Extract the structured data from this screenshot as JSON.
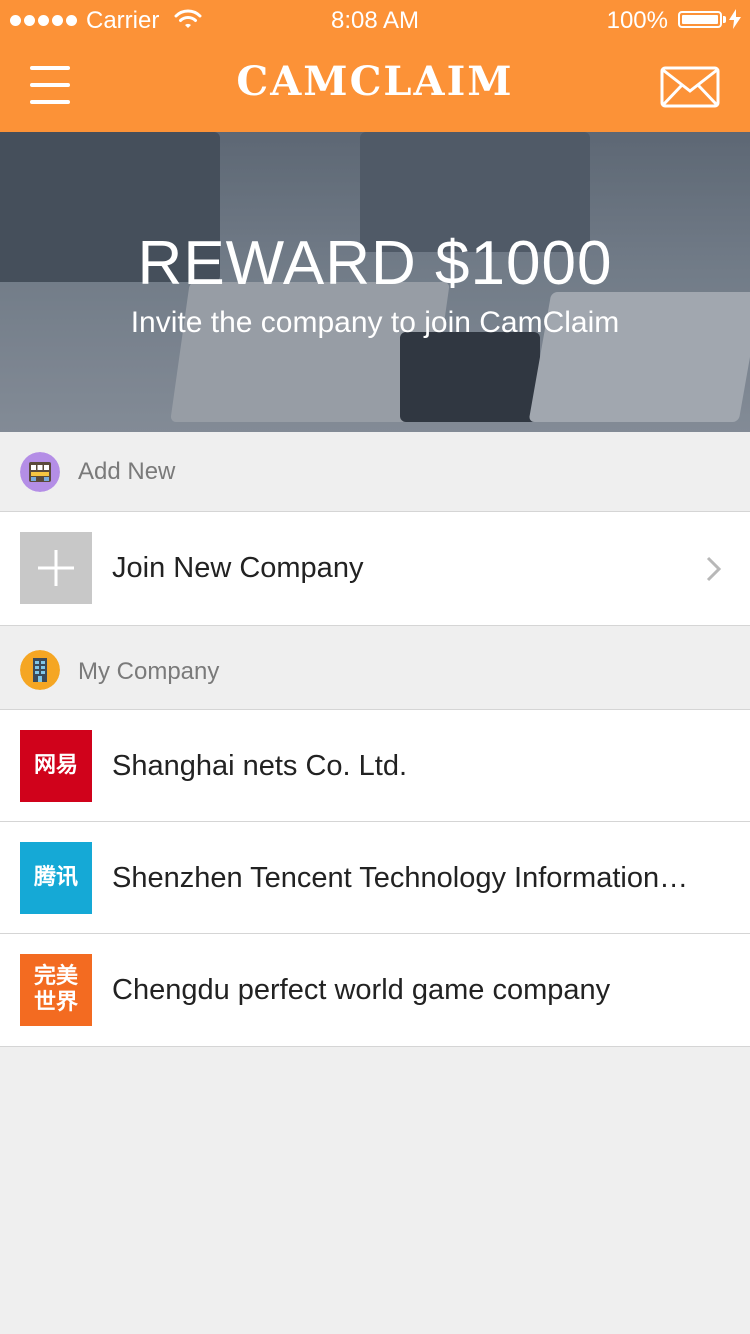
{
  "status_bar": {
    "carrier": "Carrier",
    "time": "8:08 AM",
    "battery": "100%"
  },
  "nav": {
    "logo": "CAMCLAIM",
    "menu_icon": "hamburger-menu-icon",
    "mail_icon": "mail-envelope-icon"
  },
  "banner": {
    "title": "REWARD $1000",
    "subtitle": "Invite the company to join CamClaim"
  },
  "add_new": {
    "section_label": "Add New",
    "section_icon": "store-icon",
    "join_label": "Join New Company",
    "join_icon": "plus-icon"
  },
  "my_company": {
    "section_label": "My Company",
    "section_icon": "building-icon",
    "companies": [
      {
        "logo_text": "网易",
        "name": "Shanghai nets Co. Ltd.",
        "color": "#d0021b"
      },
      {
        "logo_text": "腾讯",
        "name": "Shenzhen Tencent Technology Information…",
        "color": "#15a9d6"
      },
      {
        "logo_text": "完美世界",
        "name": "Chengdu perfect world game company",
        "color": "#f36b21"
      }
    ]
  },
  "colors": {
    "accent": "#fc9237",
    "background": "#efefef"
  }
}
